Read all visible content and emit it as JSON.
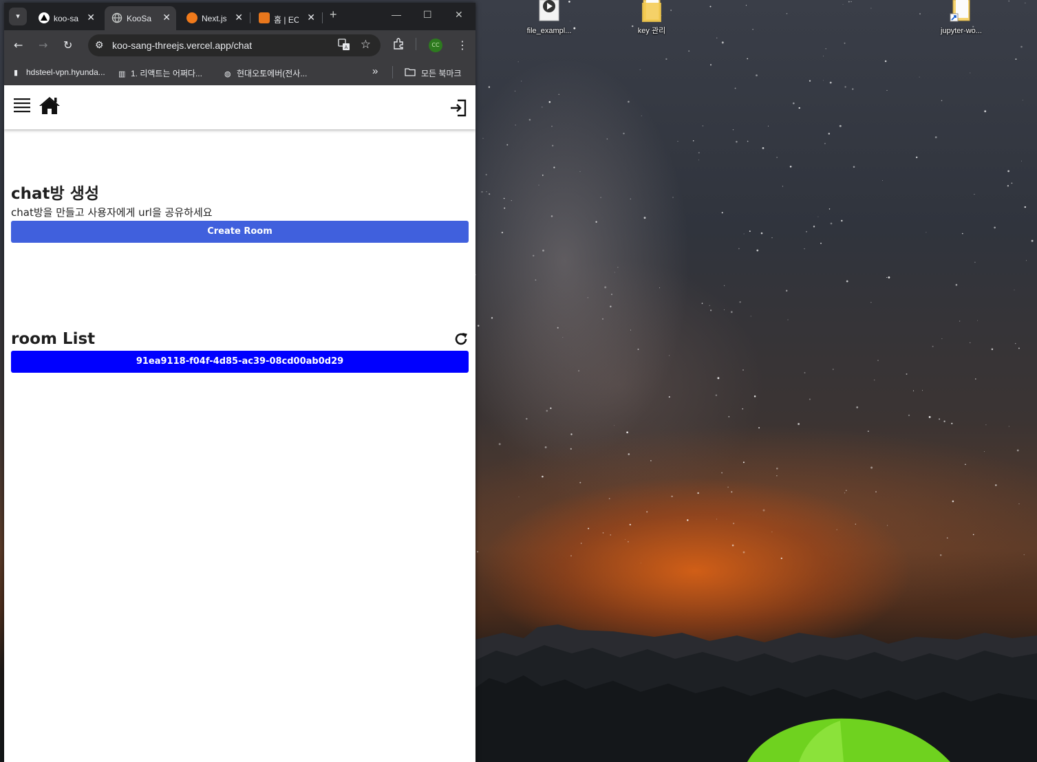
{
  "desktop": {
    "icons": [
      {
        "label": "file_exampl...",
        "icon": "video-file-icon"
      },
      {
        "label": "key 관리",
        "icon": "folder-icon"
      },
      {
        "label": "jupyter-wo...",
        "icon": "folder-shortcut-icon"
      }
    ]
  },
  "browser": {
    "tabs": [
      {
        "title": "koo-sa",
        "icon": "vercel-icon",
        "color": "#000000"
      },
      {
        "title": "KooSa",
        "icon": "globe-icon",
        "color": "#9aa0a6",
        "active": true
      },
      {
        "title": "Next.js",
        "icon": "nextjs-icon",
        "color": "#f07a1b"
      },
      {
        "title": "홈 | EC",
        "icon": "ec-icon",
        "color": "#e8771c"
      }
    ],
    "new_tab": "+",
    "address": "koo-sang-threejs.vercel.app/chat",
    "profile_badge": "CC",
    "bookmarks": [
      {
        "label": "hdsteel-vpn.hyunda..."
      },
      {
        "label": "1. 리액트는 어쩌다..."
      },
      {
        "label": "현대오토에버(전사..."
      }
    ],
    "bookmarks_overflow": "»",
    "all_bookmarks": "모든 북마크"
  },
  "app": {
    "header": {
      "menu_icon": "hamburger-icon",
      "home_icon": "home-icon",
      "login_icon": "login-icon"
    },
    "create": {
      "title": "chat방 생성",
      "description": "chat방을 만들고 사용자에게 url을 공유하세요",
      "button_label": "Create Room",
      "button_color": "#4060dd"
    },
    "rooms": {
      "title": "room List",
      "items": [
        "91ea9118-f04f-4d85-ac39-08cd00ab0d29"
      ],
      "item_color": "#0000ff"
    }
  }
}
